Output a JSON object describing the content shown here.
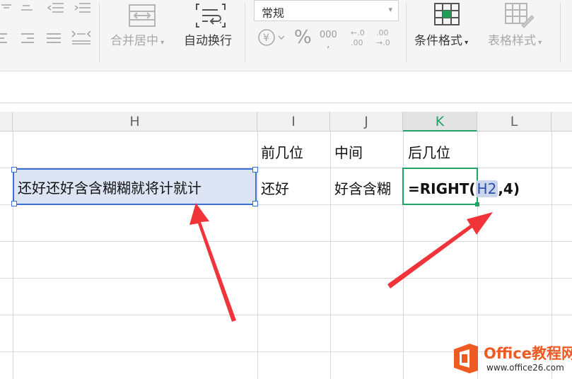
{
  "ribbon": {
    "merge_center_label": "合并居中",
    "wrap_text_label": "自动换行",
    "number_format_value": "常规",
    "percent_symbol": "%",
    "thousands_symbol": "000",
    "conditional_format_label": "条件格式",
    "table_style_label": "表格样式"
  },
  "columns": [
    "H",
    "I",
    "J",
    "K",
    "L"
  ],
  "cells": {
    "I1": "前几位",
    "J1": "中间",
    "K1": "后几位",
    "H2": "还好还好含含糊糊就将计就计",
    "I2": "还好",
    "J2": "好含含糊",
    "K2_formula_prefix": "=RIGHT(",
    "K2_formula_ref": "H2",
    "K2_formula_suffix": ",4)"
  },
  "watermark": {
    "brand": "Office教程网",
    "url": "www.office26.com"
  },
  "colors": {
    "accent_green": "#21a366",
    "selection_blue": "#3b6fd3",
    "selection_fill": "#dde5f4",
    "arrow_red": "#f0343a",
    "logo_orange": "#ee5a24"
  }
}
